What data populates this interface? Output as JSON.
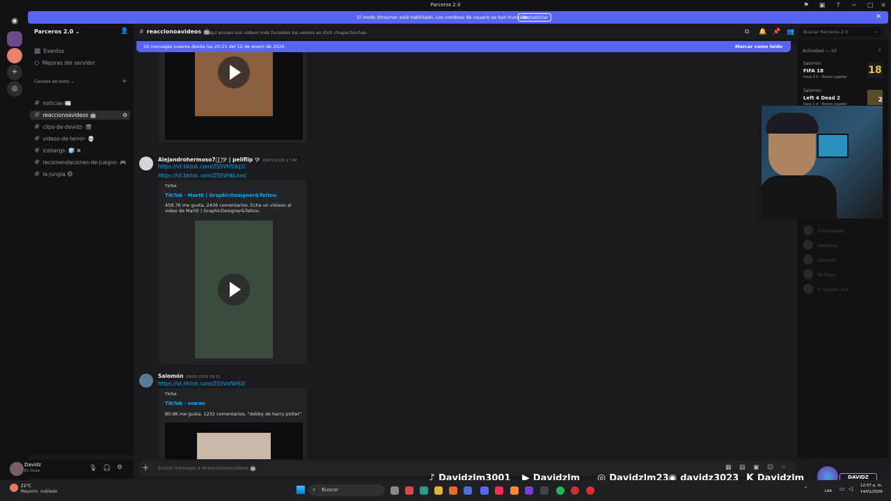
{
  "window": {
    "title": "Parceros 2.0"
  },
  "banner": {
    "text": "El modo Streamer está habilitado. Los nombres de usuario se han truncado.",
    "button": "Deshabilitar"
  },
  "server": {
    "name": "Parceros 2.0",
    "events": "Eventos",
    "boosts": "Mejoras del servidor",
    "category": "Canales de texto",
    "channels": [
      {
        "label": "noticias-📰",
        "active": false
      },
      {
        "label": "reaccionoavideos 🤖",
        "active": true
      },
      {
        "label": "clips-de-davidz- 🎬",
        "active": false
      },
      {
        "label": "videos-de-terror- 💀",
        "active": false
      },
      {
        "label": "icebergs- 🧊 ✖",
        "active": false
      },
      {
        "label": "recomendaciones-de-juegos- 🎮",
        "active": false
      },
      {
        "label": "la-jungla 🐵",
        "active": false
      }
    ]
  },
  "header": {
    "channel": "reaccionoavideos 🤖",
    "topic": "Aquí envien sus videos más funables los vemos en Kick chupachochas",
    "search_placeholder": "Buscar Parceros 2.0"
  },
  "new_messages": {
    "text": "10 mensajes nuevos desde las 20:21 del 12 de enero de 2026",
    "action": "Marcar como leído"
  },
  "messages": [
    {
      "author": "Alejandrohermoso7ア⃒ツ | peliflip ツ",
      "time": "09/01/2026 17:48",
      "links": [
        "https://vt.tiktok.com/ZS5VHS9q3/",
        "https://vt.tiktok.com/ZS5VHbLkm/"
      ],
      "embed": {
        "site": "TikTok",
        "title": "TikTok · MartE | GraphicDesigner&Tattoo",
        "desc": "459.7K me gusta, 2436 comentarios. Echa un vistazo al video de MartE | GraphicDesigner&Tattoo."
      }
    },
    {
      "author": "Salomón",
      "time": "09/01/2026 18:15",
      "links": [
        "https://vt.tiktok.com/ZS5VxfW92/"
      ],
      "embed": {
        "site": "TikTok",
        "title": "TikTok · omran",
        "desc": "80.9K me gusta, 1232 comentarios. \"dobby de harry potter\""
      }
    }
  ],
  "composer": {
    "placeholder": "Enviar mensaje a #reaccionoavideos 🤖"
  },
  "user": {
    "name": "Davidz",
    "status": "En línea"
  },
  "activity": {
    "title": "Actividad — 10",
    "cards": [
      {
        "user": "Salomón",
        "game": "FIFA 18",
        "meta": "hace 3 h · Nuevo jugador",
        "badge": "18"
      },
      {
        "user": "Salomón",
        "game": "Left 4 Dead 2",
        "meta": "hace 1 d · Nuevo jugador",
        "badge": "2"
      }
    ],
    "members": [
      "GulielHeeze",
      "Ubredixe",
      "Salomón",
      "TerrIago",
      "Ti viejotin evo"
    ]
  },
  "weather": {
    "temp": "21°C",
    "desc": "Mayorm. nublado"
  },
  "taskbar": {
    "search": "Buscar",
    "time": "12:57 a. m.",
    "date": "14/01/2026",
    "lang": "LAA"
  },
  "overlay": {
    "brand": "DAVIDZ",
    "socials": [
      {
        "icon": "tiktok-icon",
        "handle": "Davidzlm3001"
      },
      {
        "icon": "youtube-icon",
        "handle": "Davidzlm"
      },
      {
        "icon": "instagram-icon",
        "handle": "Davidzlm23"
      },
      {
        "icon": "discord-icon",
        "handle": "davidz3023"
      },
      {
        "icon": "kick-icon",
        "handle": "Davidzlm"
      }
    ]
  },
  "colors": {
    "accent": "#5865f2",
    "link": "#00a8fc",
    "background": "#1a1a1e",
    "sidebar": "#121214"
  }
}
